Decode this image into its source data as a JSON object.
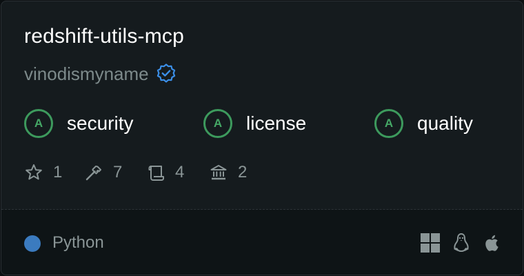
{
  "card": {
    "title": "redshift-utils-mcp",
    "author": "vinodismyname",
    "verified_icon": "verified-badge-icon",
    "grades": [
      {
        "grade": "A",
        "label": "security"
      },
      {
        "grade": "A",
        "label": "license"
      },
      {
        "grade": "A",
        "label": "quality"
      }
    ],
    "stats": {
      "stars": "1",
      "tools": "7",
      "scripts": "4",
      "institutions": "2"
    },
    "footer": {
      "language": "Python",
      "language_color": "#3b7bbf",
      "platforms": [
        "windows-icon",
        "linux-icon",
        "apple-icon"
      ]
    }
  },
  "colors": {
    "grade_accent": "#3d9a5d",
    "verified_accent": "#3b8fe8"
  }
}
